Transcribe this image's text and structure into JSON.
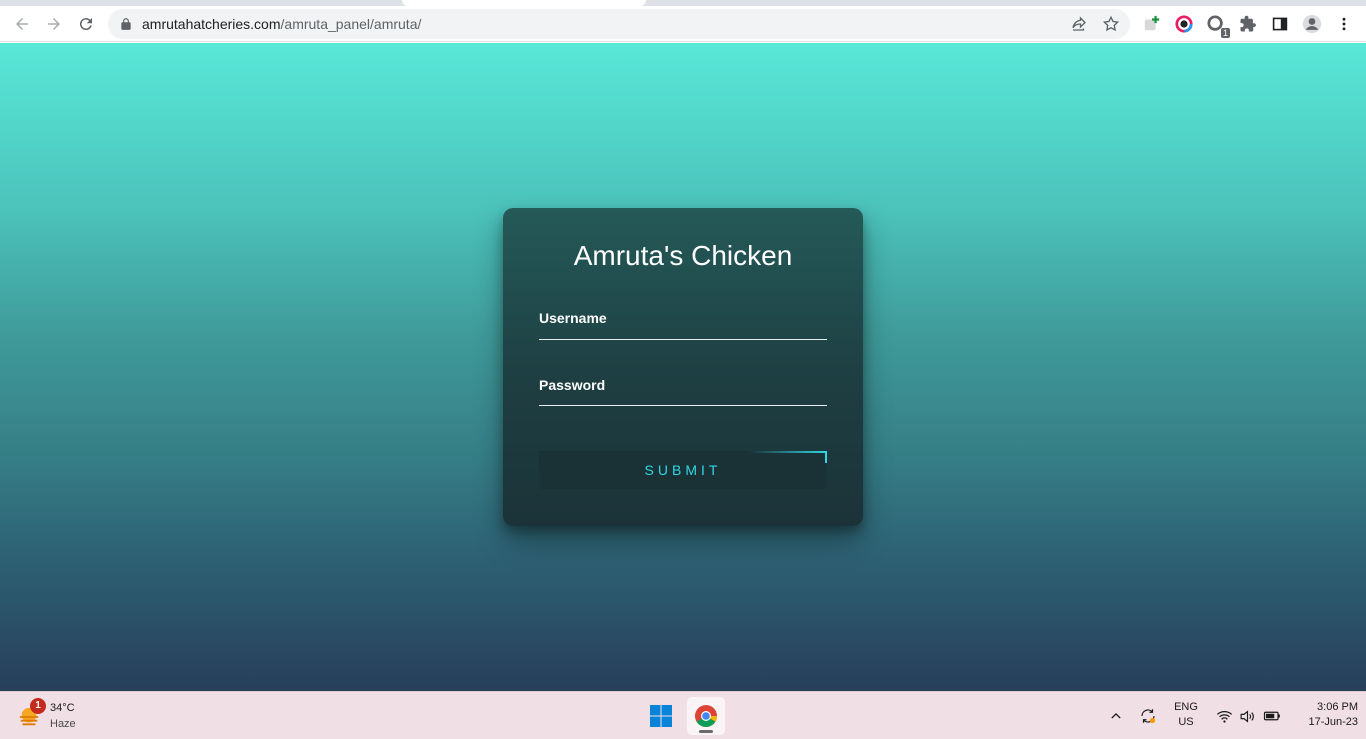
{
  "browser": {
    "url_domain": "amrutahatcheries.com",
    "url_path": "/amruta_panel/amruta/",
    "extension_badge": "1"
  },
  "login": {
    "title": "Amruta's Chicken",
    "username_label": "Username",
    "password_label": "Password",
    "submit_label": "SUBMIT"
  },
  "taskbar": {
    "weather_temp": "34°C",
    "weather_condition": "Haze",
    "weather_badge": "1",
    "lang_primary": "ENG",
    "lang_secondary": "US",
    "time": "3:06 PM",
    "date": "17-Jun-23"
  },
  "colors": {
    "accent": "#30d8e6",
    "card_top": "#245a58",
    "card_bottom": "#1b3338",
    "page_top": "#58e8d8",
    "page_bottom": "#283f5a"
  }
}
